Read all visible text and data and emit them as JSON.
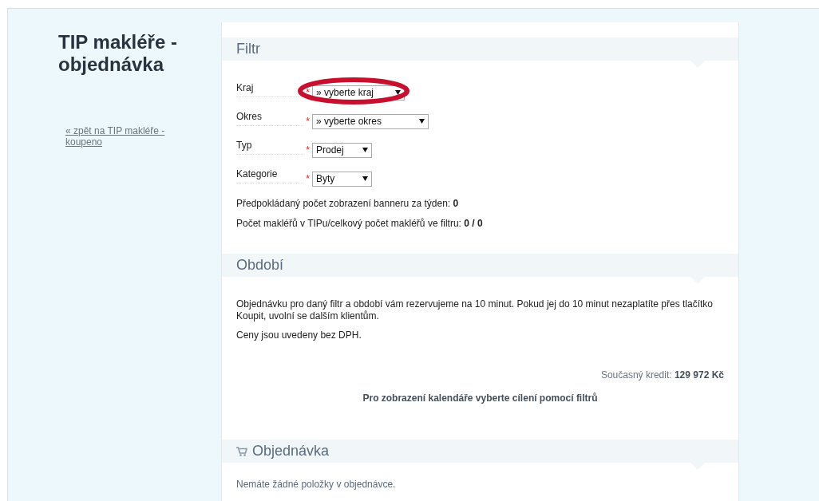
{
  "page": {
    "title": "TIP makléře - objednávka",
    "back_link": "« zpět na TIP makléře - koupeno"
  },
  "filter": {
    "heading": "Filtr",
    "fields": [
      {
        "label": "Kraj",
        "required_mark": "*",
        "value": "» vyberte kraj",
        "annotated": true
      },
      {
        "label": "Okres",
        "required_mark": "*",
        "value": "» vyberte okres",
        "annotated": false
      },
      {
        "label": "Typ",
        "required_mark": "*",
        "value": "Prodej",
        "annotated": false
      },
      {
        "label": "Kategorie",
        "required_mark": "*",
        "value": "Byty",
        "annotated": false
      }
    ],
    "stats": [
      "Předpokládaný počet zobrazení banneru za týden: **0**",
      "Počet makléřů v TIPu/celkový počet makléřů ve filtru: **0 / 0**"
    ]
  },
  "period": {
    "heading": "Období",
    "paragraphs": [
      "Objednávku pro daný filtr a období vám rezervujeme na 10 minut. Pokud jej do 10 minut nezaplatíte přes tlačítko Koupit, uvolní se dalším klientům.",
      "Ceny jsou uvedeny bez DPH."
    ],
    "credit": "Současný kredit: **129 972 Kč**",
    "calendar_note": "Pro zobrazení kalendáře vyberte cílení pomocí filtrů"
  },
  "order": {
    "heading": "Objednávka",
    "empty_note": "Nemáte žádné položky v objednávce."
  }
}
